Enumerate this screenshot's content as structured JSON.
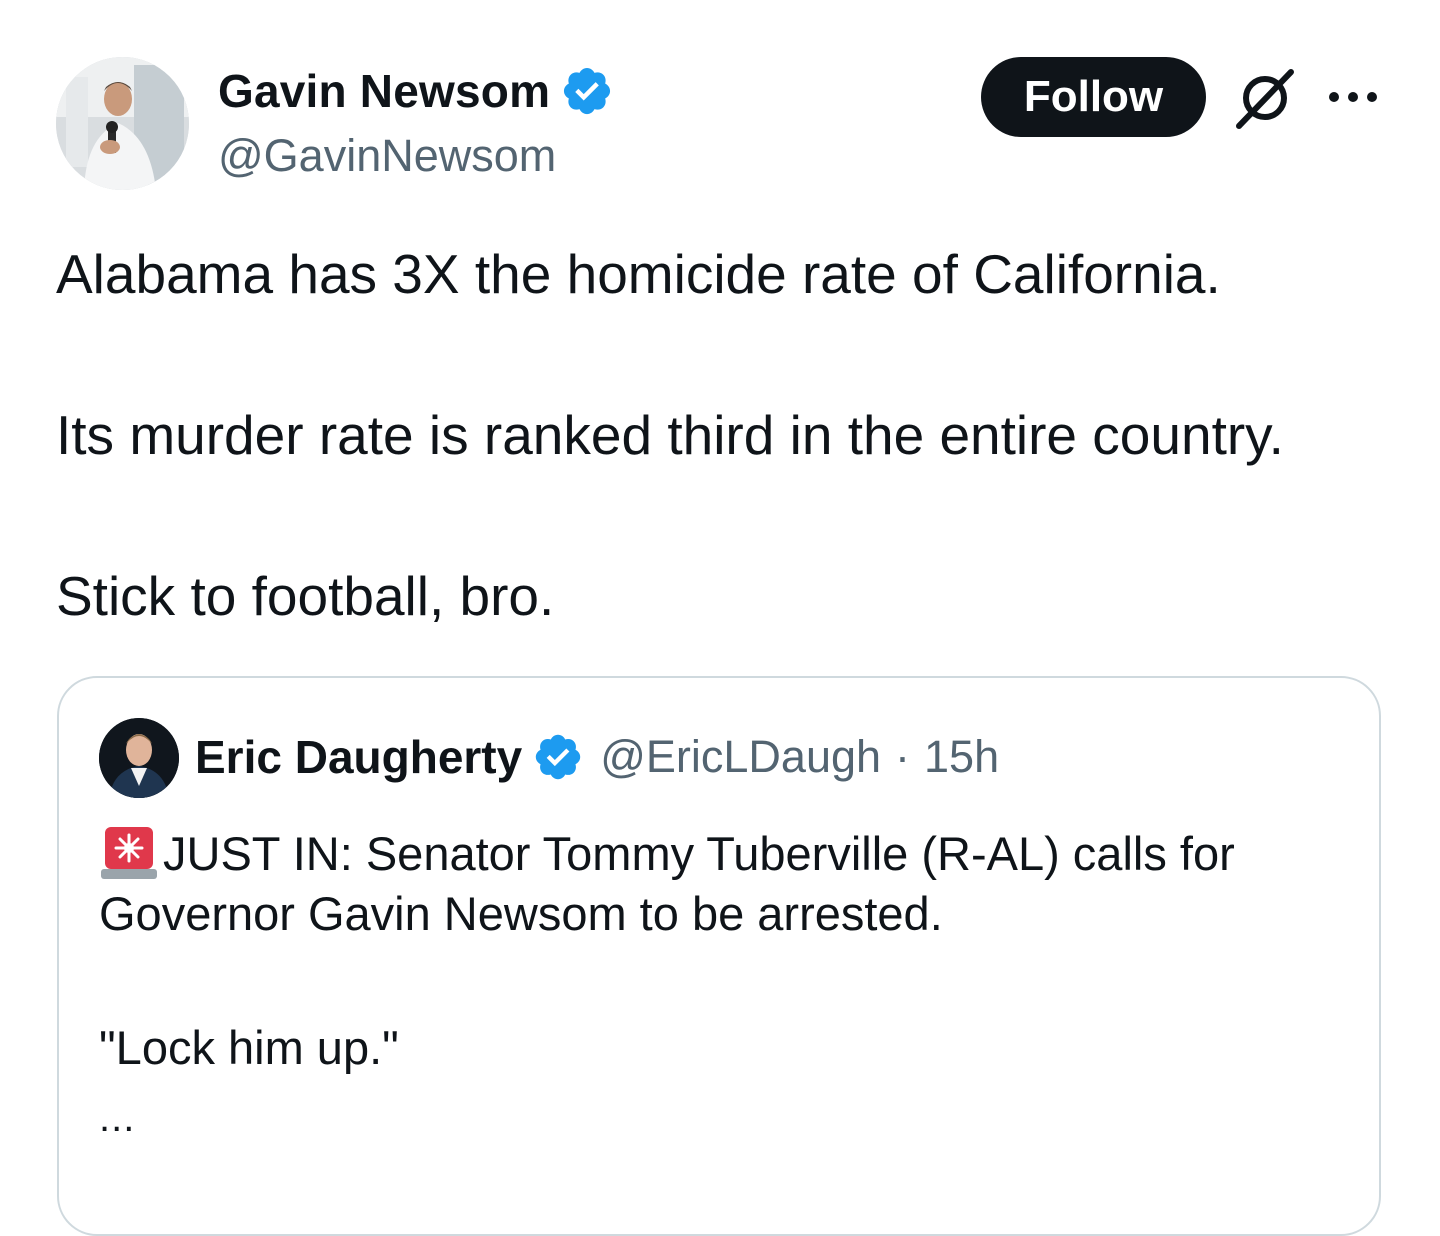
{
  "author": {
    "display_name": "Gavin Newsom",
    "handle": "@GavinNewsom",
    "verified": true
  },
  "actions": {
    "follow_label": "Follow",
    "grok_icon": "grok-icon",
    "more_icon": "more-options-icon"
  },
  "tweet": {
    "paragraphs": [
      "Alabama has 3X the homicide rate of California.",
      "Its murder rate is ranked third in the entire country.",
      "Stick to football, bro."
    ]
  },
  "quoted_tweet": {
    "display_name": "Eric Daugherty",
    "handle": "@EricLDaugh",
    "separator": "·",
    "time": "15h",
    "verified": true,
    "emoji_icon": "siren-icon",
    "lines": [
      "JUST IN: Senator Tommy Tuberville (R-AL) calls for",
      "Governor Gavin Newsom to be arrested.",
      "\"Lock him up.\""
    ],
    "truncation": "..."
  },
  "colors": {
    "text_primary": "#0f1419",
    "text_secondary": "#536471",
    "verified_blue": "#1d9bf0",
    "follow_bg": "#0f1419",
    "border": "#cfd9de"
  }
}
